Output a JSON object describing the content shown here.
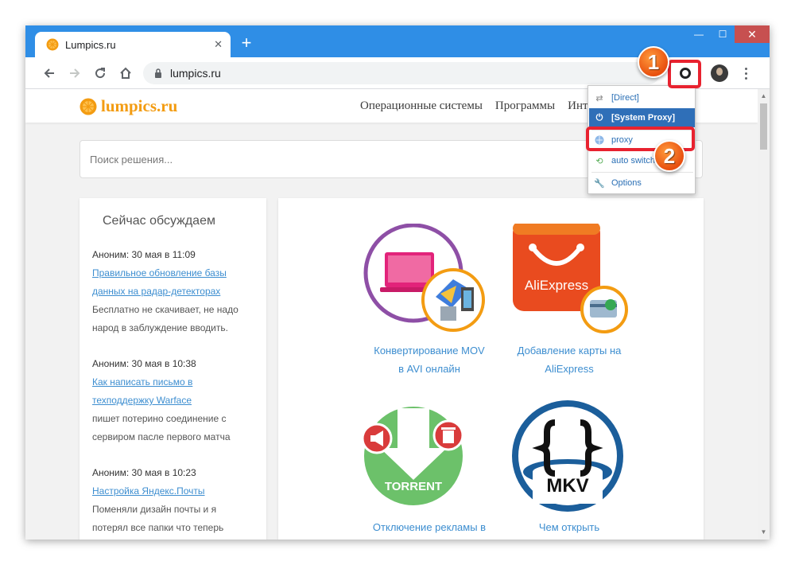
{
  "browser": {
    "tab_title": "Lumpics.ru",
    "tab_close": "✕",
    "new_tab": "+",
    "url": "lumpics.ru",
    "window_controls": {
      "minimize": "—",
      "maximize": "☐",
      "close": "✕"
    }
  },
  "site": {
    "logo": "lumpics.ru",
    "nav": [
      "Операционные системы",
      "Программы",
      "Интер"
    ],
    "search_placeholder": "Поиск решения..."
  },
  "sidebar": {
    "title": "Сейчас обсуждаем",
    "comments": [
      {
        "meta": "Аноним: 30 мая в 11:09",
        "link": "Правильное обновление базы данных на радар-детекторах",
        "text": "Бесплатно не скачивает, не надо народ в заблуждение вводить."
      },
      {
        "meta": "Аноним: 30 мая в 10:38",
        "link": "Как написать письмо в техподдержку Warface",
        "text": "пишет потерино соединение с сервиром пасле первого матча"
      },
      {
        "meta": "Аноним: 30 мая в 10:23",
        "link": "Настройка Яндекс.Почты",
        "text": "Поменяли дизайн почты и я потерял все папки что теперь делать"
      }
    ]
  },
  "cards": [
    {
      "caption_line1": "Конвертирование MOV",
      "caption_line2": "в AVI онлайн"
    },
    {
      "caption_line1": "Добавление карты на",
      "caption_line2": "AliExpress",
      "logo_text": "AliExpress"
    },
    {
      "caption_line1": "Отключение рекламы в",
      "caption_line2": "",
      "logo_text": "TORRENT"
    },
    {
      "caption_line1": "Чем открыть",
      "caption_line2": "",
      "logo_text": "MKV"
    }
  ],
  "proxy_menu": {
    "items": [
      {
        "label": "[Direct]",
        "active": false
      },
      {
        "label": "[System Proxy]",
        "active": true
      },
      {
        "label": "proxy",
        "active": false
      },
      {
        "label": "auto switch",
        "active": false
      },
      {
        "label": "Options",
        "active": false
      }
    ]
  },
  "annotations": {
    "badge1": "1",
    "badge2": "2"
  },
  "colors": {
    "titlebar": "#2f8ee6",
    "highlight": "#e8222f",
    "badge": "#e8500f",
    "link": "#3d8ed0",
    "logo": "#f39c12",
    "menu_active": "#2f6fb8"
  }
}
